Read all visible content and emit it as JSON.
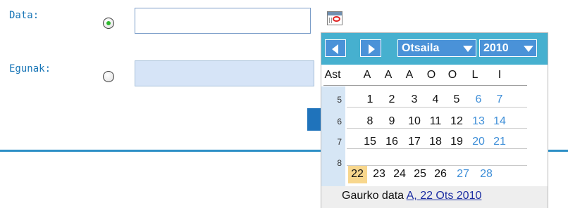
{
  "form": {
    "data_label": "Data:",
    "egunak_label": "Egunak:",
    "data_value": "",
    "egunak_value": ""
  },
  "calendar": {
    "month": "Otsaila",
    "year": "2010",
    "week_header": "Ast",
    "weekdays": [
      "A",
      "A",
      "A",
      "O",
      "O",
      "L",
      "I"
    ],
    "weeks": [
      {
        "wk": "5",
        "days": [
          "1",
          "2",
          "3",
          "4",
          "5",
          "6",
          "7"
        ]
      },
      {
        "wk": "6",
        "days": [
          "8",
          "9",
          "10",
          "11",
          "12",
          "13",
          "14"
        ]
      },
      {
        "wk": "7",
        "days": [
          "15",
          "16",
          "17",
          "18",
          "19",
          "20",
          "21"
        ]
      },
      {
        "wk": "8",
        "days": [
          "22",
          "23",
          "24",
          "25",
          "26",
          "27",
          "28"
        ]
      }
    ],
    "selected_day": "22",
    "footer_label": "Gaurko data",
    "footer_date": "A, 22 Ots 2010"
  },
  "colors": {
    "accent": "#46b0cf",
    "link": "#1976b7",
    "highlight": "#f8d78d",
    "weekend": "#3f8fd8"
  }
}
